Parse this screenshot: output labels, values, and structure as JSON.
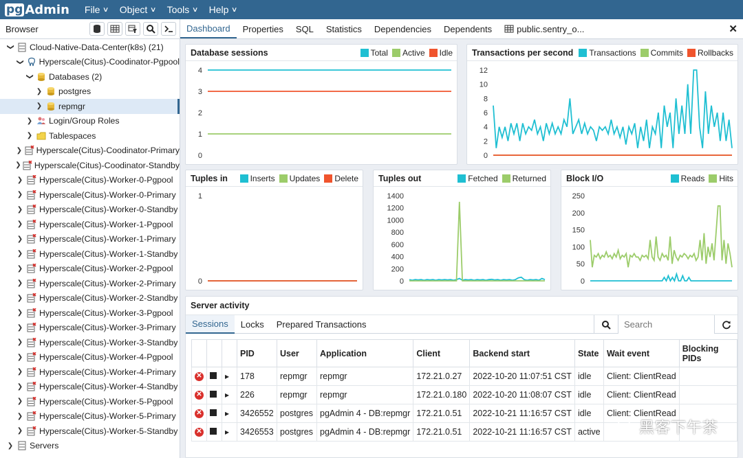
{
  "app": {
    "logo_pg": "pg",
    "logo_admin": "Admin",
    "menus": [
      "File",
      "Object",
      "Tools",
      "Help"
    ]
  },
  "browser": {
    "title": "Browser",
    "tree": [
      {
        "label": "Cloud-Native-Data-Center(k8s) (21)",
        "level": 0,
        "toggle": "open",
        "icon": "server-group"
      },
      {
        "label": "Hyperscale(Citus)-Coodinator-Pgpool",
        "level": 1,
        "toggle": "open",
        "icon": "elephant"
      },
      {
        "label": "Databases (2)",
        "level": 2,
        "toggle": "open",
        "icon": "databases"
      },
      {
        "label": "postgres",
        "level": 3,
        "toggle": "closed",
        "icon": "database"
      },
      {
        "label": "repmgr",
        "level": 3,
        "toggle": "closed",
        "icon": "database",
        "selected": true
      },
      {
        "label": "Login/Group Roles",
        "level": 2,
        "toggle": "closed",
        "icon": "roles"
      },
      {
        "label": "Tablespaces",
        "level": 2,
        "toggle": "closed",
        "icon": "tablespaces"
      },
      {
        "label": "Hyperscale(Citus)-Coodinator-Primary",
        "level": 1,
        "toggle": "closed",
        "icon": "server-x"
      },
      {
        "label": "Hyperscale(Citus)-Coodinator-Standby",
        "level": 1,
        "toggle": "closed",
        "icon": "server-x"
      },
      {
        "label": "Hyperscale(Citus)-Worker-0-Pgpool",
        "level": 1,
        "toggle": "closed",
        "icon": "server-x"
      },
      {
        "label": "Hyperscale(Citus)-Worker-0-Primary",
        "level": 1,
        "toggle": "closed",
        "icon": "server-x"
      },
      {
        "label": "Hyperscale(Citus)-Worker-0-Standby",
        "level": 1,
        "toggle": "closed",
        "icon": "server-x"
      },
      {
        "label": "Hyperscale(Citus)-Worker-1-Pgpool",
        "level": 1,
        "toggle": "closed",
        "icon": "server-x"
      },
      {
        "label": "Hyperscale(Citus)-Worker-1-Primary",
        "level": 1,
        "toggle": "closed",
        "icon": "server-x"
      },
      {
        "label": "Hyperscale(Citus)-Worker-1-Standby",
        "level": 1,
        "toggle": "closed",
        "icon": "server-x"
      },
      {
        "label": "Hyperscale(Citus)-Worker-2-Pgpool",
        "level": 1,
        "toggle": "closed",
        "icon": "server-x"
      },
      {
        "label": "Hyperscale(Citus)-Worker-2-Primary",
        "level": 1,
        "toggle": "closed",
        "icon": "server-x"
      },
      {
        "label": "Hyperscale(Citus)-Worker-2-Standby",
        "level": 1,
        "toggle": "closed",
        "icon": "server-x"
      },
      {
        "label": "Hyperscale(Citus)-Worker-3-Pgpool",
        "level": 1,
        "toggle": "closed",
        "icon": "server-x"
      },
      {
        "label": "Hyperscale(Citus)-Worker-3-Primary",
        "level": 1,
        "toggle": "closed",
        "icon": "server-x"
      },
      {
        "label": "Hyperscale(Citus)-Worker-3-Standby",
        "level": 1,
        "toggle": "closed",
        "icon": "server-x"
      },
      {
        "label": "Hyperscale(Citus)-Worker-4-Pgpool",
        "level": 1,
        "toggle": "closed",
        "icon": "server-x"
      },
      {
        "label": "Hyperscale(Citus)-Worker-4-Primary",
        "level": 1,
        "toggle": "closed",
        "icon": "server-x"
      },
      {
        "label": "Hyperscale(Citus)-Worker-4-Standby",
        "level": 1,
        "toggle": "closed",
        "icon": "server-x"
      },
      {
        "label": "Hyperscale(Citus)-Worker-5-Pgpool",
        "level": 1,
        "toggle": "closed",
        "icon": "server-x"
      },
      {
        "label": "Hyperscale(Citus)-Worker-5-Primary",
        "level": 1,
        "toggle": "closed",
        "icon": "server-x"
      },
      {
        "label": "Hyperscale(Citus)-Worker-5-Standby",
        "level": 1,
        "toggle": "closed",
        "icon": "server-x"
      },
      {
        "label": "Servers",
        "level": 0,
        "toggle": "closed",
        "icon": "server-group"
      }
    ]
  },
  "tabs": [
    "Dashboard",
    "Properties",
    "SQL",
    "Statistics",
    "Dependencies",
    "Dependents",
    "public.sentry_o..."
  ],
  "active_tab": "Dashboard",
  "colors": {
    "teal": "#1fbfd2",
    "green": "#9ccc6a",
    "red": "#f0542d",
    "brand": "#326690"
  },
  "chart_data": [
    {
      "id": "db-sessions",
      "type": "line",
      "title": "Database sessions",
      "ylim": [
        0,
        4
      ],
      "yticks": [
        0,
        1,
        2,
        3,
        4
      ],
      "series": [
        {
          "name": "Total",
          "color": "#1fbfd2",
          "values": [
            4,
            4
          ]
        },
        {
          "name": "Active",
          "color": "#9ccc6a",
          "values": [
            1,
            1
          ]
        },
        {
          "name": "Idle",
          "color": "#f0542d",
          "values": [
            3,
            3
          ]
        }
      ]
    },
    {
      "id": "tps",
      "type": "line",
      "title": "Transactions per second",
      "ylim": [
        0,
        12
      ],
      "yticks": [
        0,
        2,
        4,
        6,
        8,
        10,
        12
      ],
      "series": [
        {
          "name": "Transactions",
          "color": "#1fbfd2",
          "values": [
            7,
            1,
            4,
            2.5,
            4,
            2,
            4.5,
            3,
            4.5,
            2,
            4.5,
            3,
            4,
            3.5,
            5,
            3,
            4,
            2,
            4.5,
            3,
            4.5,
            3,
            4,
            3,
            5,
            4,
            8,
            3,
            4,
            5,
            3,
            4.5,
            3,
            4,
            3.5,
            2,
            4,
            3.5,
            4,
            3,
            5,
            3,
            4,
            2.5,
            4,
            1.5,
            4,
            3,
            4.5,
            1,
            4,
            2,
            5,
            1,
            4,
            3,
            6,
            1,
            7,
            4,
            6,
            1,
            8,
            3,
            7,
            3,
            10,
            3,
            12,
            12,
            4,
            1,
            9,
            3,
            7,
            4,
            6,
            2,
            6,
            2,
            5,
            1
          ]
        },
        {
          "name": "Commits",
          "color": "#9ccc6a",
          "values": [
            0,
            0
          ]
        },
        {
          "name": "Rollbacks",
          "color": "#f0542d",
          "values": [
            0,
            0
          ]
        }
      ]
    },
    {
      "id": "tuples-in",
      "type": "line",
      "title": "Tuples in",
      "ylim": [
        0,
        1
      ],
      "yticks": [
        0,
        1
      ],
      "series": [
        {
          "name": "Inserts",
          "color": "#1fbfd2",
          "values": [
            0,
            0
          ]
        },
        {
          "name": "Updates",
          "color": "#9ccc6a",
          "values": [
            0,
            0
          ]
        },
        {
          "name": "Delete",
          "color": "#f0542d",
          "values": [
            0,
            0
          ]
        }
      ]
    },
    {
      "id": "tuples-out",
      "type": "line",
      "title": "Tuples out",
      "ylim": [
        0,
        1400
      ],
      "yticks": [
        0,
        200,
        400,
        600,
        800,
        1000,
        1200,
        1400
      ],
      "series": [
        {
          "name": "Fetched",
          "color": "#1fbfd2",
          "values": [
            20,
            10,
            20,
            15,
            20,
            10,
            20,
            15,
            20,
            10,
            20,
            15,
            20,
            15,
            20,
            10,
            20,
            40,
            10,
            20,
            15,
            20,
            10,
            20,
            15,
            20,
            10,
            20,
            25,
            15,
            20,
            10,
            20,
            15,
            20,
            10,
            20,
            50,
            60,
            20,
            10,
            20,
            15,
            20,
            10,
            40,
            20
          ]
        },
        {
          "name": "Returned",
          "color": "#9ccc6a",
          "values": [
            0,
            0,
            0,
            0,
            0,
            0,
            0,
            0,
            0,
            0,
            0,
            0,
            0,
            0,
            0,
            0,
            0,
            1300,
            0,
            0,
            0,
            0,
            0,
            0,
            0,
            0,
            0,
            0,
            0,
            0,
            0,
            0,
            0,
            0,
            0,
            0,
            0,
            0,
            0,
            0,
            0,
            0,
            0,
            0,
            0,
            0,
            0
          ]
        }
      ]
    },
    {
      "id": "block-io",
      "type": "line",
      "title": "Block I/O",
      "ylim": [
        0,
        250
      ],
      "yticks": [
        0,
        50,
        100,
        150,
        200,
        250
      ],
      "series": [
        {
          "name": "Reads",
          "color": "#1fbfd2",
          "values": [
            0,
            0,
            0,
            0,
            0,
            0,
            0,
            0,
            0,
            0,
            0,
            0,
            0,
            0,
            0,
            0,
            0,
            0,
            0,
            0,
            0,
            0,
            0,
            0,
            0,
            0,
            0,
            0,
            0,
            0,
            0,
            0,
            0,
            0,
            0,
            0,
            10,
            0,
            15,
            0,
            10,
            0,
            20,
            0,
            0,
            15,
            0,
            0,
            10,
            0,
            0,
            0,
            0,
            0,
            0,
            0,
            0,
            0,
            0,
            0,
            0,
            0,
            0,
            0,
            0,
            0,
            0,
            0,
            0,
            0
          ]
        },
        {
          "name": "Hits",
          "color": "#9ccc6a",
          "values": [
            120,
            40,
            75,
            70,
            80,
            65,
            75,
            70,
            85,
            70,
            75,
            65,
            80,
            70,
            90,
            65,
            75,
            70,
            80,
            40,
            75,
            70,
            80,
            70,
            70,
            60,
            75,
            70,
            75,
            65,
            120,
            70,
            60,
            130,
            70,
            60,
            80,
            70,
            75,
            60,
            130,
            50,
            90,
            70,
            60,
            75,
            70,
            80,
            75,
            65,
            75,
            70,
            80,
            60,
            70,
            120,
            60,
            140,
            50,
            100,
            70,
            110,
            60,
            140,
            220,
            220,
            60,
            120,
            50,
            110,
            80,
            40
          ]
        }
      ]
    }
  ],
  "server_activity": {
    "title": "Server activity",
    "tabs": [
      "Sessions",
      "Locks",
      "Prepared Transactions"
    ],
    "search_placeholder": "Search",
    "columns": [
      "",
      "",
      "",
      "PID",
      "User",
      "Application",
      "Client",
      "Backend start",
      "State",
      "Wait event",
      "Blocking PIDs"
    ],
    "rows": [
      [
        "178",
        "repmgr",
        "repmgr",
        "172.21.0.27",
        "2022-10-20 11:07:51 CST",
        "idle",
        "Client: ClientRead",
        ""
      ],
      [
        "226",
        "repmgr",
        "repmgr",
        "172.21.0.180",
        "2022-10-20 11:08:07 CST",
        "idle",
        "Client: ClientRead",
        ""
      ],
      [
        "3426552",
        "postgres",
        "pgAdmin 4 - DB:repmgr",
        "172.21.0.51",
        "2022-10-21 11:16:57 CST",
        "idle",
        "Client: ClientRead",
        ""
      ],
      [
        "3426553",
        "postgres",
        "pgAdmin 4 - DB:repmgr",
        "172.21.0.51",
        "2022-10-21 11:16:57 CST",
        "active",
        "",
        ""
      ]
    ]
  },
  "watermark": "黑客下午茶"
}
